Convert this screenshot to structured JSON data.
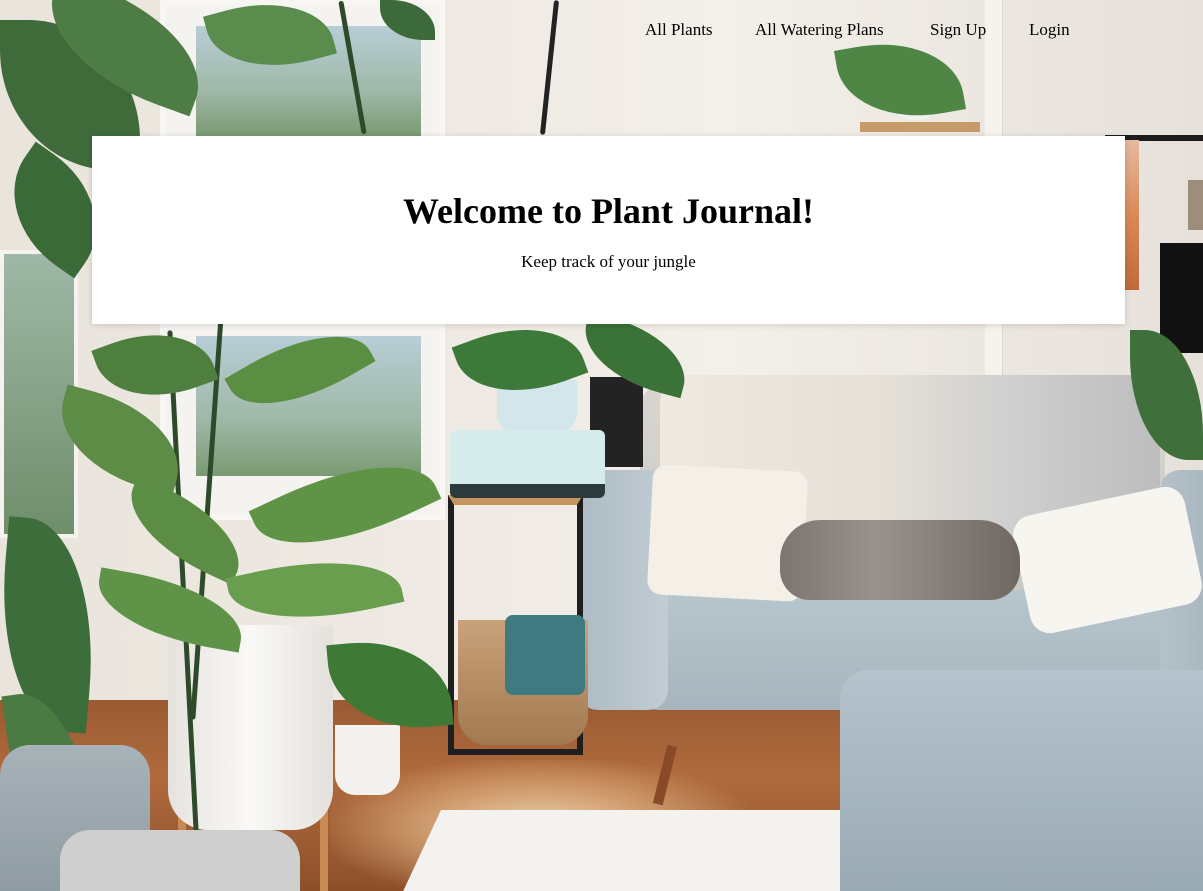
{
  "nav": {
    "items": [
      {
        "label": "All Plants"
      },
      {
        "label": "All Watering Plans"
      },
      {
        "label": "Sign Up"
      },
      {
        "label": "Login"
      }
    ]
  },
  "hero": {
    "title": "Welcome to Plant Journal!",
    "subtitle": "Keep track of your jungle"
  },
  "colors": {
    "card_background": "#ffffff",
    "text": "#000000"
  }
}
